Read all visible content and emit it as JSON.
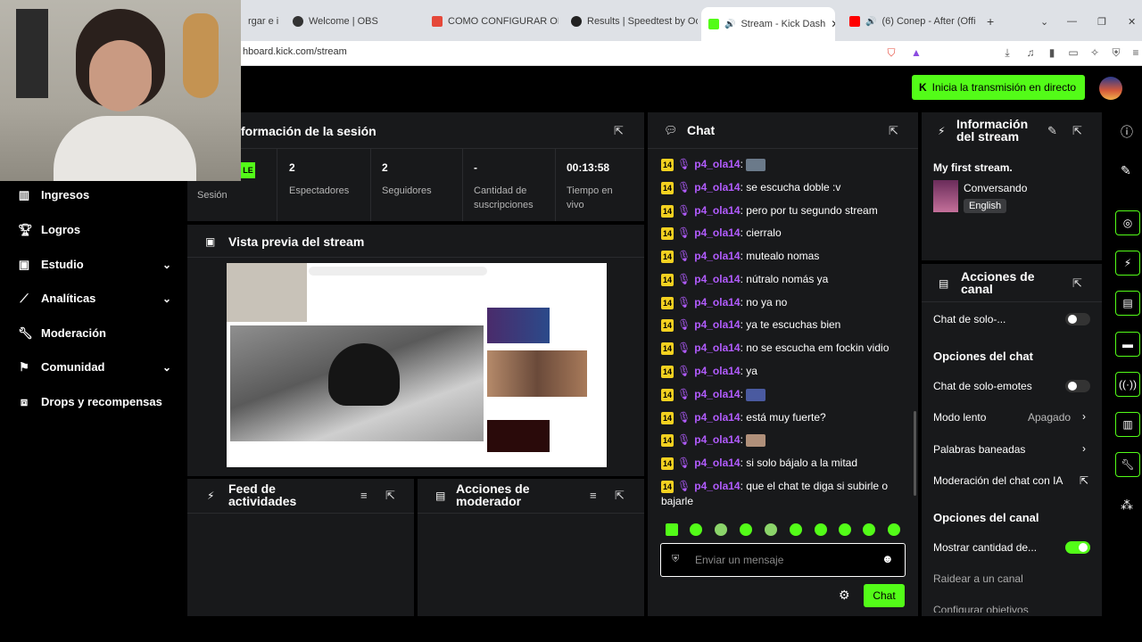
{
  "browser": {
    "tabs": [
      {
        "label": "rgar e i"
      },
      {
        "label": "Welcome | OBS"
      },
      {
        "label": "COMO CONFIGURAR OBS"
      },
      {
        "label": "Results | Speedtest by Ook"
      },
      {
        "label": "Stream - Kick Dash"
      },
      {
        "label": "(6) Conep - After (Offici"
      }
    ],
    "url": "hboard.kick.com/stream"
  },
  "header": {
    "golive_label": "Inicia la transmisión en directo"
  },
  "sidebar": {
    "items": [
      {
        "label": "Ingresos",
        "icon": "bar-chart-icon"
      },
      {
        "label": "Logros",
        "icon": "trophy-icon"
      },
      {
        "label": "Estudio",
        "icon": "studio-icon"
      },
      {
        "label": "Analíticas",
        "icon": "analytics-icon"
      },
      {
        "label": "Moderación",
        "icon": "wrench-icon"
      },
      {
        "label": "Comunidad",
        "icon": "community-icon"
      },
      {
        "label": "Drops y recompensas",
        "icon": "gift-icon"
      }
    ]
  },
  "session": {
    "title": "formación de la sesión",
    "badge": "LE",
    "session_label": "Sesión",
    "stats": [
      {
        "value": "2",
        "label": "Espectadores"
      },
      {
        "value": "2",
        "label": "Seguidores"
      },
      {
        "value": "-",
        "label": "Cantidad de suscripciones"
      },
      {
        "value": "00:13:58",
        "label": "Tiempo en vivo"
      }
    ]
  },
  "preview": {
    "title": "Vista previa del stream"
  },
  "feed": {
    "title": "Feed de actividades"
  },
  "modactions": {
    "title": "Acciones de moderador"
  },
  "chat": {
    "title": "Chat",
    "messages": [
      {
        "badge": "14",
        "user": "p4_ola14",
        "text": ""
      },
      {
        "badge": "14",
        "user": "p4_ola14",
        "text": "se escucha doble :v"
      },
      {
        "badge": "14",
        "user": "p4_ola14",
        "text": "pero por tu segundo stream"
      },
      {
        "badge": "14",
        "user": "p4_ola14",
        "text": "cierralo"
      },
      {
        "badge": "14",
        "user": "p4_ola14",
        "text": "mutealo nomas"
      },
      {
        "badge": "14",
        "user": "p4_ola14",
        "text": "nútralo nomás ya"
      },
      {
        "badge": "14",
        "user": "p4_ola14",
        "text": "no ya no"
      },
      {
        "badge": "14",
        "user": "p4_ola14",
        "text": "ya te escuchas bien"
      },
      {
        "badge": "14",
        "user": "p4_ola14",
        "text": "no se escucha em fockin vidio"
      },
      {
        "badge": "14",
        "user": "p4_ola14",
        "text": "ya"
      },
      {
        "badge": "14",
        "user": "p4_ola14",
        "text": ""
      },
      {
        "badge": "14",
        "user": "p4_ola14",
        "text": "está muy fuerte?"
      },
      {
        "badge": "14",
        "user": "p4_ola14",
        "text": ""
      },
      {
        "badge": "14",
        "user": "p4_ola14",
        "text": "si solo bájalo a la mitad"
      },
      {
        "badge": "14",
        "user": "p4_ola14",
        "text": "que el chat te diga si subirle o bajarle"
      }
    ],
    "input_placeholder": "Enviar un mensaje",
    "send_label": "Chat"
  },
  "streaminfo": {
    "title_line1": "Información",
    "title_line2": "del stream",
    "stream_title": "My first stream.",
    "category": "Conversando",
    "language": "English"
  },
  "channel": {
    "title_line1": "Acciones de",
    "title_line2": "canal",
    "rows": [
      {
        "label": "Chat de solo-...",
        "toggle": false
      },
      {
        "section": "Opciones del chat"
      },
      {
        "label": "Chat de solo-emotes",
        "toggle": false
      },
      {
        "label": "Modo lento",
        "value": "Apagado"
      },
      {
        "label": "Palabras baneadas"
      },
      {
        "label": "Moderación del chat con IA"
      },
      {
        "section": "Opciones del canal"
      },
      {
        "label": "Mostrar cantidad de...",
        "toggle": true
      },
      {
        "label": "Raidear a un canal"
      },
      {
        "label": "Configurar objetivos"
      }
    ]
  },
  "colors": {
    "accent": "#53fc18",
    "username": "#b25cff",
    "panel": "#18191b"
  }
}
